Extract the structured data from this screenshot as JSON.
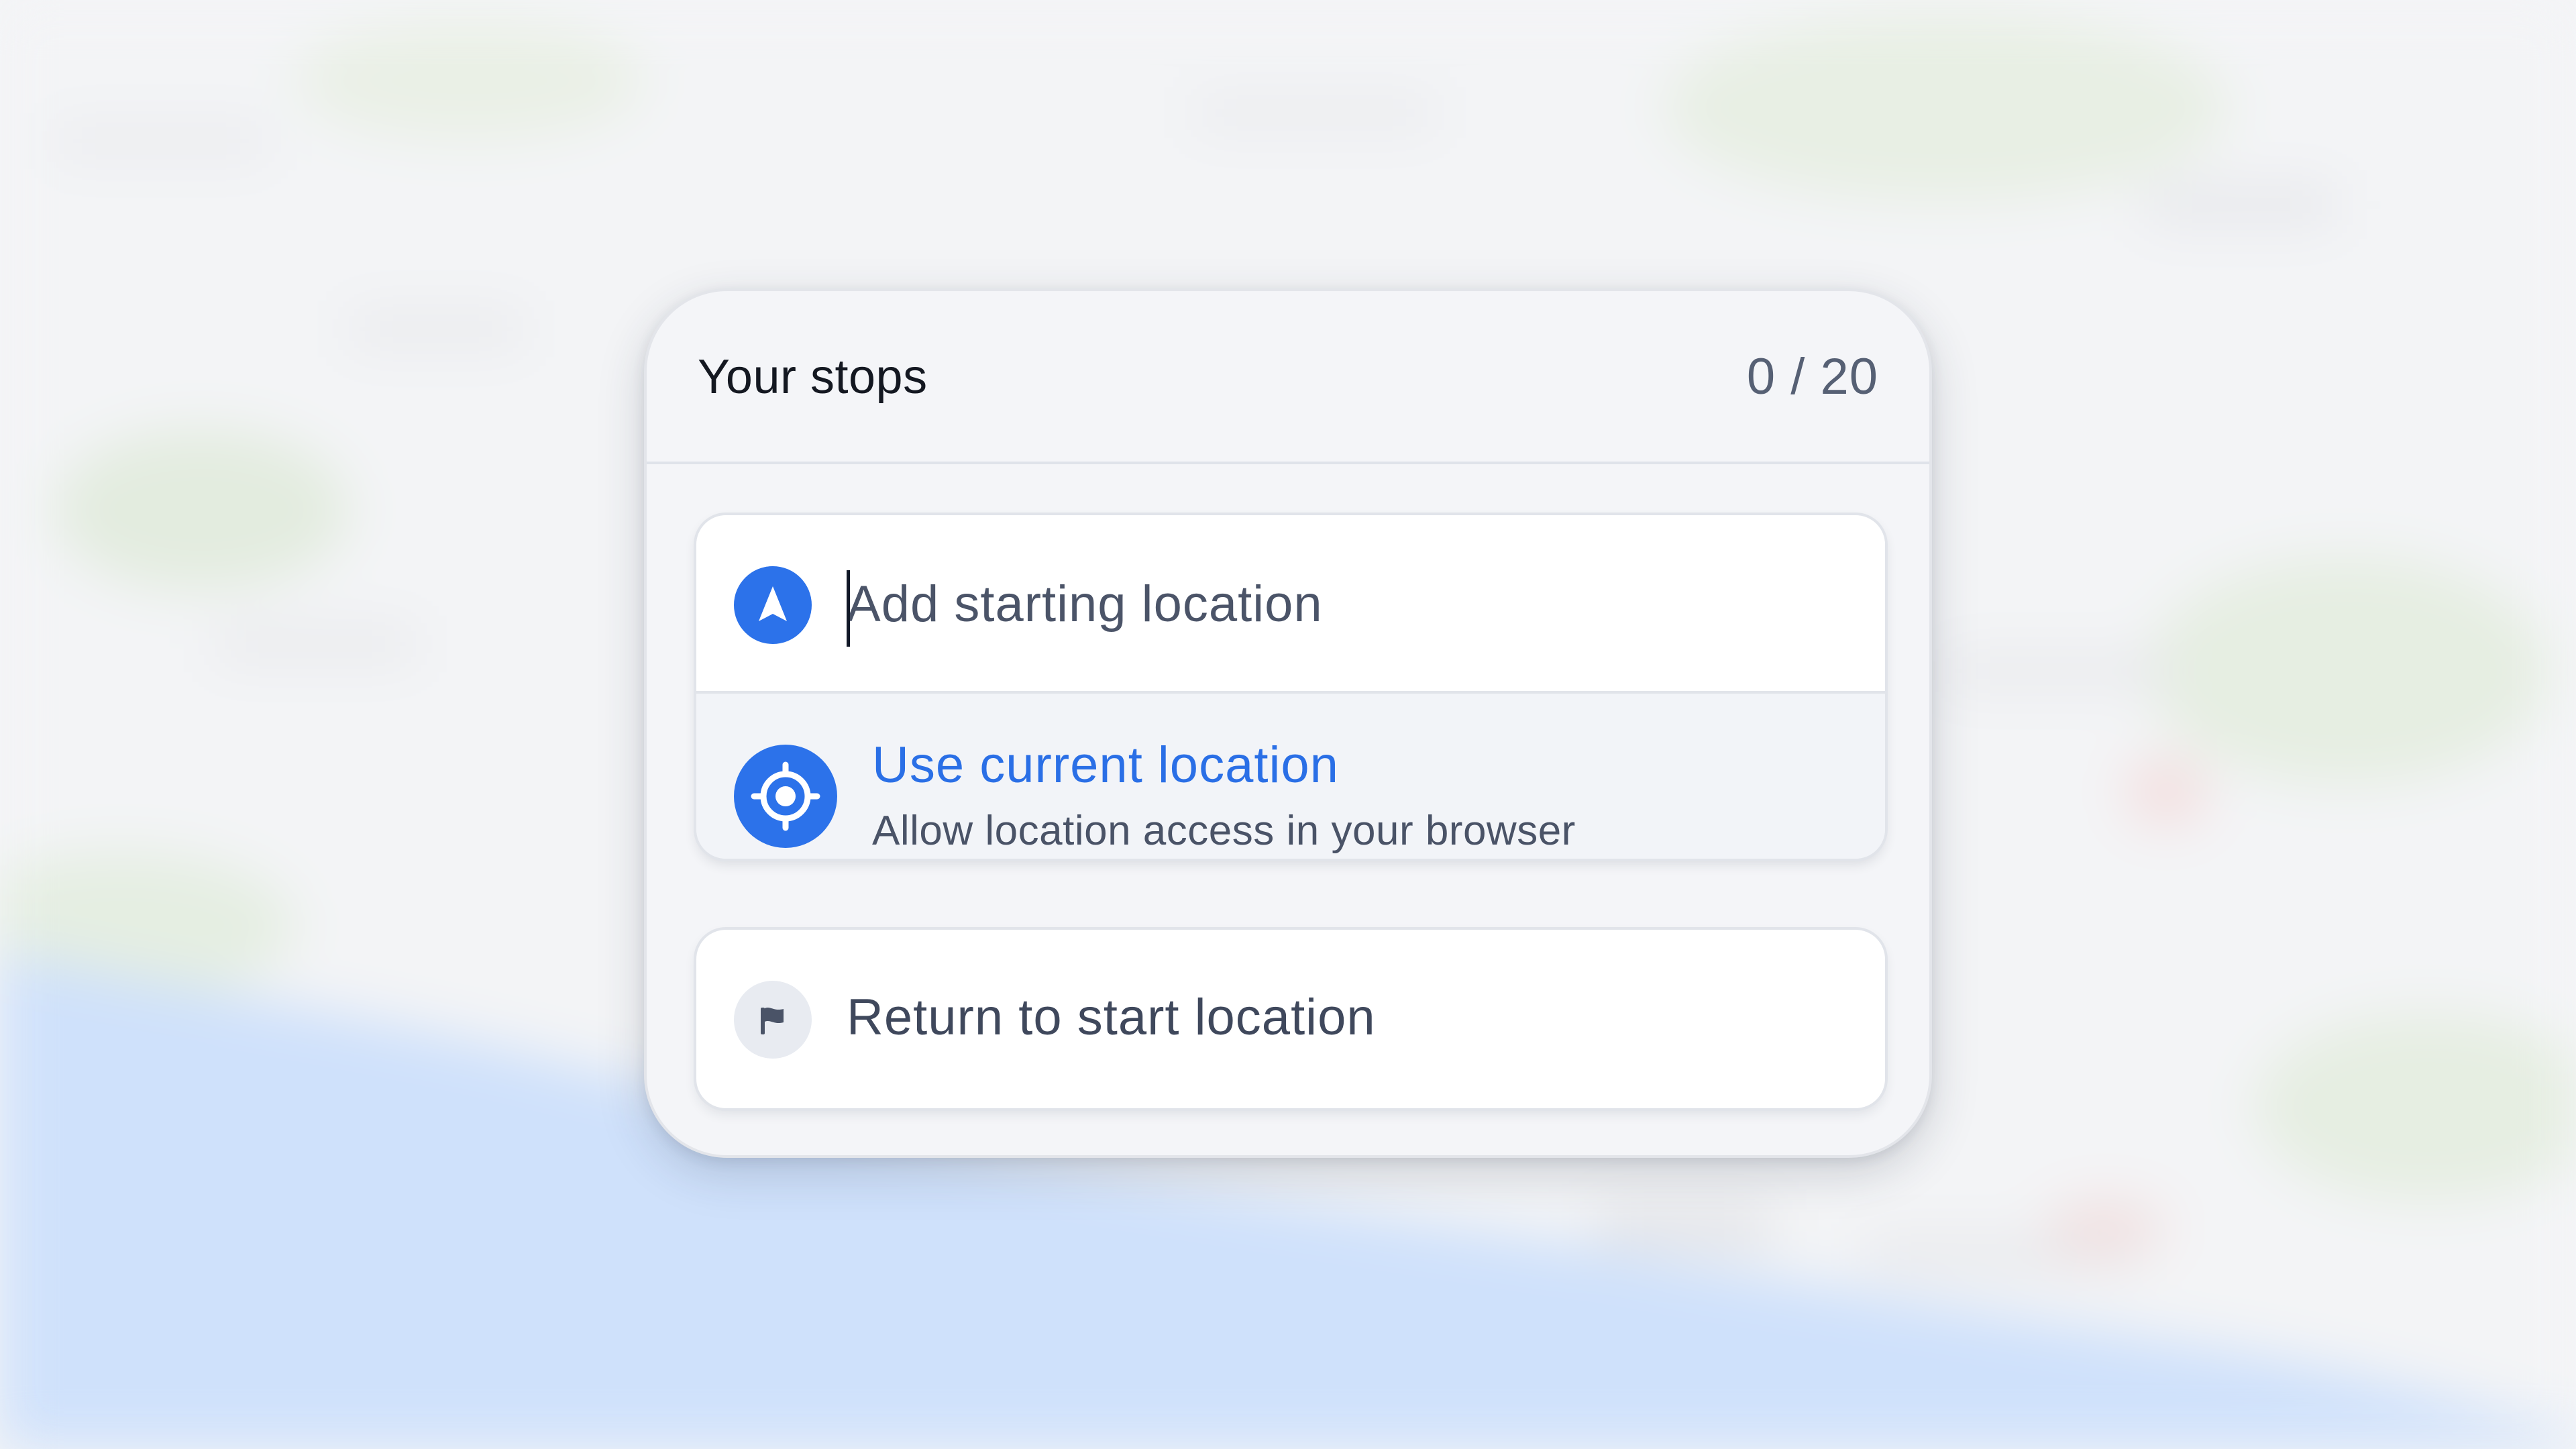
{
  "panel": {
    "title": "Your stops",
    "stop_count": "0 / 20"
  },
  "start_location": {
    "placeholder": "Add starting location",
    "value": "",
    "icon": "navigation-arrow-icon"
  },
  "current_location": {
    "label": "Use current location",
    "sublabel": "Allow location access in your browser",
    "icon": "crosshair-icon"
  },
  "return_option": {
    "label": "Return to start location",
    "icon": "flag-icon"
  },
  "colors": {
    "accent": "#2c72ea",
    "water": "#cfe1fb",
    "panel_background": "#f4f5f8"
  }
}
